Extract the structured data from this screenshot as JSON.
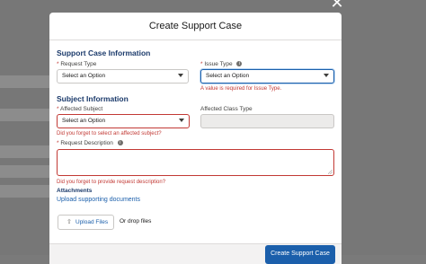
{
  "window": {
    "close_glyph": "✕"
  },
  "modal": {
    "title": "Create Support Case",
    "support_info": {
      "heading": "Support Case Information",
      "request_type": {
        "required_mark": "*",
        "label": "Request Type",
        "value": "Select an Option"
      },
      "issue_type": {
        "required_mark": "*",
        "label": "Issue Type",
        "info": "i",
        "value": "Select an Option",
        "error": "A value is required for Issue Type."
      }
    },
    "subject_info": {
      "heading": "Subject Information",
      "affected_subject": {
        "required_mark": "*",
        "label": "Affected Subject",
        "value": "Select an Option",
        "error": "Did you forget to select an affected subject?"
      },
      "affected_class_type": {
        "label": "Affected Class Type",
        "value": ""
      },
      "request_description": {
        "required_mark": "*",
        "label": "Request Description",
        "info": "i",
        "value": "",
        "error": "Did you forget to provide request description?"
      }
    },
    "attachments": {
      "heading": "Attachments",
      "link": "Upload supporting documents",
      "upload_button": "Upload Files",
      "upload_icon": "upload-icon",
      "drop_text": "Or drop files"
    },
    "submit_button": "Create Support Case"
  },
  "colors": {
    "accent": "#1b5fab",
    "error": "#c23934",
    "heading": "#1b3a6b",
    "backdrop": "#777777"
  }
}
